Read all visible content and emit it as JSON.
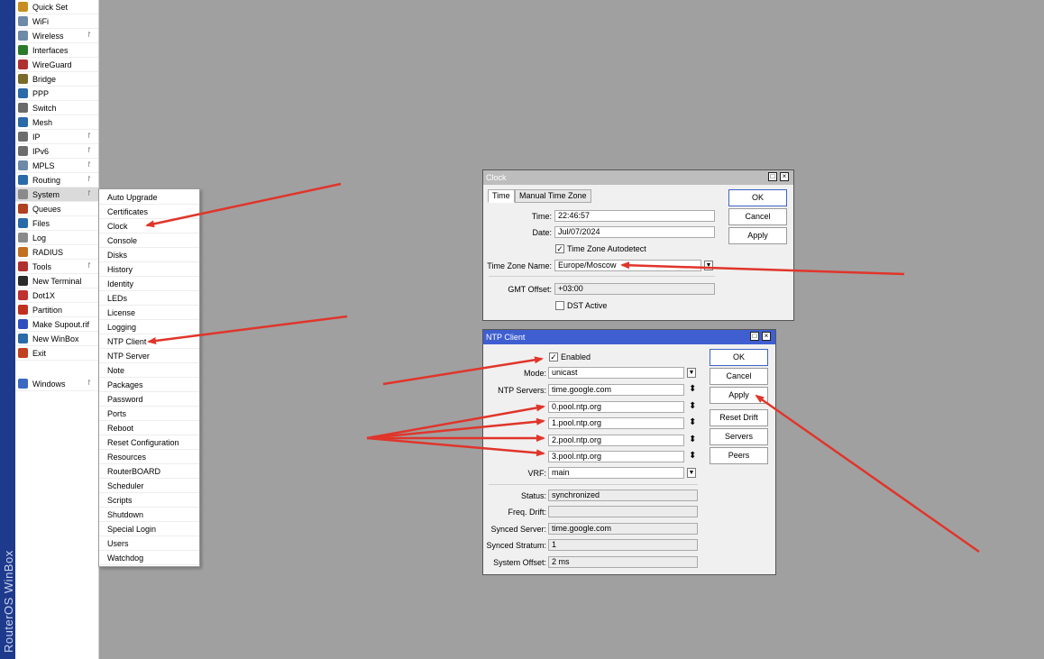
{
  "brand": "RouterOS WinBox",
  "colors": {
    "arrow": "#e0352b",
    "title_active": "#3f5fd1",
    "title_inactive": "#bdbdbd",
    "strip": "#1e3a8c"
  },
  "main_menu": [
    {
      "label": "Quick Set",
      "icon": "wand-icon",
      "submenu": false
    },
    {
      "label": "WiFi",
      "icon": "wifi-icon",
      "submenu": false
    },
    {
      "label": "Wireless",
      "icon": "wireless-icon",
      "submenu": true
    },
    {
      "label": "Interfaces",
      "icon": "interfaces-icon",
      "submenu": false
    },
    {
      "label": "WireGuard",
      "icon": "wireguard-icon",
      "submenu": false
    },
    {
      "label": "Bridge",
      "icon": "bridge-icon",
      "submenu": false
    },
    {
      "label": "PPP",
      "icon": "ppp-icon",
      "submenu": false
    },
    {
      "label": "Switch",
      "icon": "switch-icon",
      "submenu": false
    },
    {
      "label": "Mesh",
      "icon": "mesh-icon",
      "submenu": false
    },
    {
      "label": "IP",
      "icon": "ip-icon",
      "submenu": true
    },
    {
      "label": "IPv6",
      "icon": "ipv6-icon",
      "submenu": true
    },
    {
      "label": "MPLS",
      "icon": "mpls-icon",
      "submenu": true
    },
    {
      "label": "Routing",
      "icon": "routing-icon",
      "submenu": true
    },
    {
      "label": "System",
      "icon": "system-icon",
      "submenu": true
    },
    {
      "label": "Queues",
      "icon": "queues-icon",
      "submenu": false
    },
    {
      "label": "Files",
      "icon": "files-icon",
      "submenu": false
    },
    {
      "label": "Log",
      "icon": "log-icon",
      "submenu": false
    },
    {
      "label": "RADIUS",
      "icon": "radius-icon",
      "submenu": false
    },
    {
      "label": "Tools",
      "icon": "tools-icon",
      "submenu": true
    },
    {
      "label": "New Terminal",
      "icon": "terminal-icon",
      "submenu": false
    },
    {
      "label": "Dot1X",
      "icon": "dot1x-icon",
      "submenu": false
    },
    {
      "label": "Partition",
      "icon": "partition-icon",
      "submenu": false
    },
    {
      "label": "Make Supout.rif",
      "icon": "supout-icon",
      "submenu": false
    },
    {
      "label": "New WinBox",
      "icon": "winbox-icon",
      "submenu": false
    },
    {
      "label": "Exit",
      "icon": "exit-icon",
      "submenu": false
    },
    {
      "label": "Windows",
      "icon": "windows-icon",
      "submenu": true
    }
  ],
  "system_submenu": [
    "Auto Upgrade",
    "Certificates",
    "Clock",
    "Console",
    "Disks",
    "History",
    "Identity",
    "LEDs",
    "License",
    "Logging",
    "NTP Client",
    "NTP Server",
    "Note",
    "Packages",
    "Password",
    "Ports",
    "Reboot",
    "Reset Configuration",
    "Resources",
    "RouterBOARD",
    "Scheduler",
    "Scripts",
    "Shutdown",
    "Special Login",
    "Users",
    "Watchdog"
  ],
  "clock_window": {
    "title": "Clock",
    "tabs": [
      "Time",
      "Manual Time Zone"
    ],
    "time_label": "Time:",
    "time_value": "22:46:57",
    "date_label": "Date:",
    "date_value": "Jul/07/2024",
    "autodetect_label": "Time Zone Autodetect",
    "autodetect_checked": true,
    "tz_label": "Time Zone Name:",
    "tz_value": "Europe/Moscow",
    "gmt_label": "GMT Offset:",
    "gmt_value": "+03:00",
    "dst_label": "DST Active",
    "dst_checked": false,
    "buttons": {
      "ok": "OK",
      "cancel": "Cancel",
      "apply": "Apply"
    }
  },
  "ntp_window": {
    "title": "NTP Client",
    "enabled_label": "Enabled",
    "enabled_checked": true,
    "mode_label": "Mode:",
    "mode_value": "unicast",
    "servers_label": "NTP Servers:",
    "servers": [
      "time.google.com",
      "0.pool.ntp.org",
      "1.pool.ntp.org",
      "2.pool.ntp.org",
      "3.pool.ntp.org"
    ],
    "vrf_label": "VRF:",
    "vrf_value": "main",
    "status_label": "Status:",
    "status_value": "synchronized",
    "drift_label": "Freq. Drift:",
    "drift_value": "",
    "synced_server_label": "Synced Server:",
    "synced_server_value": "time.google.com",
    "synced_stratum_label": "Synced Stratum:",
    "synced_stratum_value": "1",
    "offset_label": "System Offset:",
    "offset_value": "2 ms",
    "buttons": {
      "ok": "OK",
      "cancel": "Cancel",
      "apply": "Apply",
      "reset_drift": "Reset Drift",
      "servers": "Servers",
      "peers": "Peers"
    }
  }
}
